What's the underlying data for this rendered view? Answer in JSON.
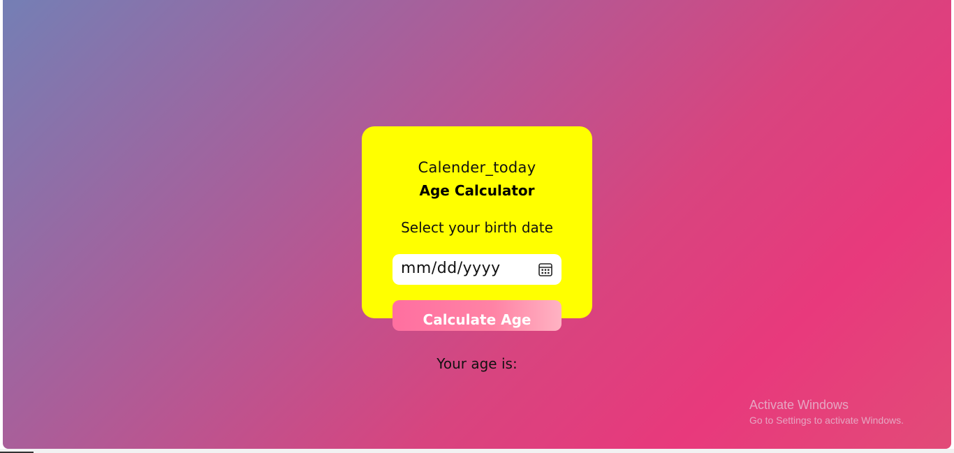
{
  "card": {
    "calendar_title": "Calender_today",
    "app_title": "Age Calculator",
    "prompt": "Select your birth date"
  },
  "date_input": {
    "placeholder": "mm/dd/yyyy",
    "icon": "calendar-icon"
  },
  "button": {
    "label": "Calculate Age"
  },
  "result": {
    "label": "Your age is:"
  },
  "watermark": {
    "title": "Activate Windows",
    "subtitle": "Go to Settings to activate Windows."
  },
  "colors": {
    "card_background": "#ffff00",
    "button_gradient_start": "#ff6fa0",
    "button_gradient_end": "#ffb3c3",
    "page_gradient_start": "#747fb5",
    "page_gradient_end": "#e8397c"
  }
}
